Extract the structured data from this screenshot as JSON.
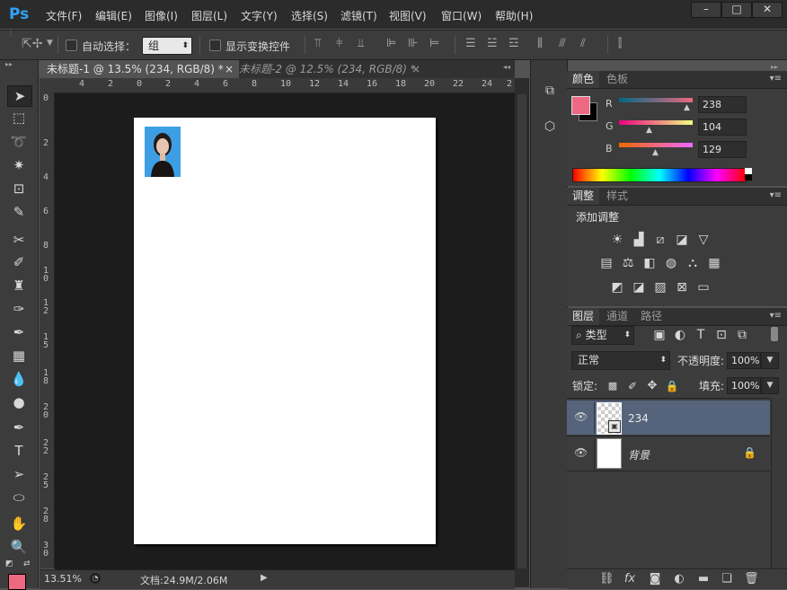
{
  "app": {
    "logo": "Ps"
  },
  "menu": [
    "文件(F)",
    "编辑(E)",
    "图像(I)",
    "图层(L)",
    "文字(Y)",
    "选择(S)",
    "滤镜(T)",
    "视图(V)",
    "窗口(W)",
    "帮助(H)"
  ],
  "window_controls": {
    "minimize": "–",
    "maximize": "□",
    "close": "✕"
  },
  "options": {
    "auto_select_label": "自动选择：",
    "auto_select_value": "组",
    "show_transform_label": "显示变换控件"
  },
  "tabs": [
    {
      "label": "未标题-1 @ 13.5% (234, RGB/8) *",
      "close": "×"
    },
    {
      "label": "未标题-2 @ 12.5% (234, RGB/8) *",
      "close": "×"
    }
  ],
  "ruler": {
    "h_labels": [
      "4",
      "2",
      "0",
      "2",
      "4",
      "6",
      "8",
      "10",
      "12",
      "14",
      "16",
      "18",
      "20",
      "22",
      "24",
      "2"
    ],
    "v_labels": [
      "0",
      "2",
      "4",
      "6",
      "8",
      "1\n0",
      "1\n2",
      "1\n5",
      "1\n8",
      "2\n0",
      "2\n2",
      "2\n5",
      "2\n8",
      "3\n0"
    ]
  },
  "status": {
    "zoom": "13.51%",
    "doc_info": "文档:24.9M/2.06M"
  },
  "color_panel": {
    "tabs": [
      "颜色",
      "色板"
    ],
    "channels": [
      {
        "label": "R",
        "value": "238"
      },
      {
        "label": "G",
        "value": "104"
      },
      {
        "label": "B",
        "value": "129"
      }
    ],
    "foreground": "#ee6881",
    "background": "#000000"
  },
  "adjust_panel": {
    "tabs": [
      "调整",
      "样式"
    ],
    "title": "添加调整"
  },
  "layers_panel": {
    "tabs": [
      "图层",
      "通道",
      "路径"
    ],
    "filter_label": "类型",
    "blend_mode": "正常",
    "opacity_label": "不透明度:",
    "opacity_value": "100%",
    "lock_label": "锁定:",
    "fill_label": "填充:",
    "fill_value": "100%",
    "layers": [
      {
        "name": "234",
        "selected": true
      },
      {
        "name": "背景",
        "selected": false
      }
    ]
  }
}
